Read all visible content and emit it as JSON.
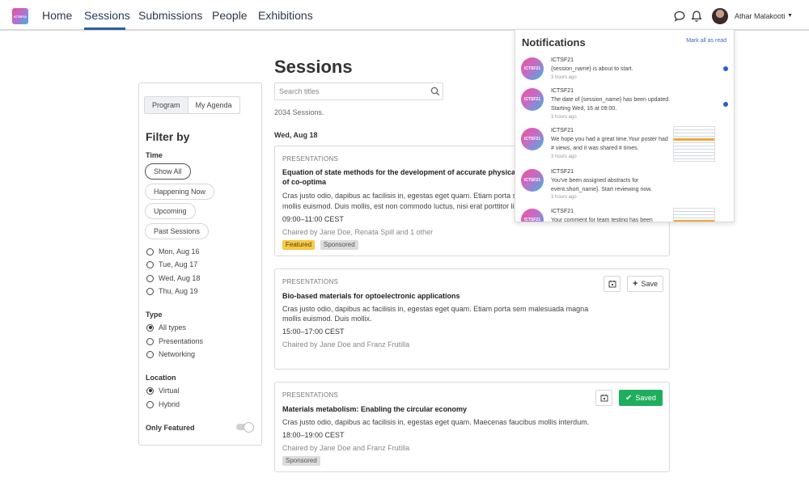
{
  "nav": {
    "logo_text": "ICTSF21",
    "items": [
      {
        "label": "Home"
      },
      {
        "label": "Sessions"
      },
      {
        "label": "Submissions"
      },
      {
        "label": "People"
      },
      {
        "label": "Exhibitions"
      }
    ],
    "active": "Sessions",
    "user_name": "Athar Malakooti"
  },
  "page": {
    "title": "Sessions"
  },
  "sidebar": {
    "tabs": [
      "Program",
      "My Agenda"
    ],
    "active_tab": "Program",
    "filter_title": "Filter by",
    "time_label": "Time",
    "time_pills": [
      "Show All",
      "Happening Now",
      "Upcoming",
      "Past Sessions"
    ],
    "time_active": "Show All",
    "days": [
      "Mon, Aug 16",
      "Tue, Aug 17",
      "Wed, Aug 18",
      "Thu, Aug 19"
    ],
    "type_label": "Type",
    "types": [
      "All types",
      "Presentations",
      "Networking"
    ],
    "type_selected": "All types",
    "location_label": "Location",
    "locations": [
      "Virtual",
      "Hybrid"
    ],
    "location_selected": "Virtual",
    "featured_label": "Only Featured",
    "featured_on": false
  },
  "search": {
    "placeholder": "Search titles"
  },
  "results": {
    "count": "2034 Sessions.",
    "date_heading": "Wed, Aug 18"
  },
  "sessions": [
    {
      "kind": "PRESENTATIONS",
      "title": "Equation of state methods for the development of accurate physical and chemical models: Ab-initio models: Ab-initio models of co-optima",
      "title_line1": "Equation of state methods for the development of accurate physical",
      "title_line2": "of co-optima",
      "desc_line1": "Cras justo odio, dapibus ac facilisis in, egestas eget quam. Etiam porta sem",
      "desc_line2": "mollis euismod. Duis mollis, est non commodo luctus, nisi erat porttitor ligu",
      "time": "09:00–11:00 CEST",
      "chair": "Chaired by Jane Doe, Renata Spill and 1 other",
      "tags": [
        "Featured",
        "Sponsored"
      ]
    },
    {
      "kind": "PRESENTATIONS",
      "title": "Bio-based materials for optoelectronic applications",
      "desc_line1": "Cras justo odio, dapibus ac facilisis in, egestas eget quam. Etiam porta sem malesuada magna",
      "desc_line2": "mollis euismod. Duis mollix.",
      "time": "15:00–17:00 CEST",
      "chair": "Chaired by Jane Doe and Franz Frutilla",
      "save_label": "Save"
    },
    {
      "kind": "PRESENTATIONS",
      "title": "Materials metabolism: Enabling the circular economy",
      "desc_line1": "Cras justo odio, dapibus ac facilisis in, egestas eget quam. Maecenas faucibus mollis interdum.",
      "time": "18:00–19:00 CEST",
      "chair": "Chaired by Jane Doe and Franz Frutilla",
      "tags": [
        "Sponsored"
      ],
      "saved_label": "Saved"
    }
  ],
  "notifications": {
    "title": "Notifications",
    "mark_all": "Mark all as read",
    "items": [
      {
        "avatar": "ICTSF21",
        "source": "ICTSF21",
        "message": "{session_name} is about to start.",
        "when": "3 hours ago",
        "unread": true
      },
      {
        "avatar": "ICTSF21",
        "source": "ICTSF21",
        "message": "The date of {session_name} has been updated. Starting Wed, 16 at 09:00.",
        "when": "3 hours ago",
        "unread": true
      },
      {
        "avatar": "ICTSF21",
        "source": "ICTSF21",
        "message": "We hope you had a great time.Your poster had # views, and it was shared # times.",
        "when": "3 hours ago",
        "unread": false
      },
      {
        "avatar": "ICTSF21",
        "source": "ICTSF21",
        "message": "You've been assigned abstracts for event.short_name}. Start reviewing now.",
        "when": "3 hours ago",
        "unread": false
      },
      {
        "avatar": "ICTSF21",
        "source": "ICTSF21",
        "message": "Your comment for team testing has been",
        "when": "",
        "unread": false
      }
    ]
  },
  "colors": {
    "accent": "#2f5f9e",
    "saved": "#1fae5e",
    "featured": "#f7c948",
    "unread_dot": "#2a5fc8"
  }
}
